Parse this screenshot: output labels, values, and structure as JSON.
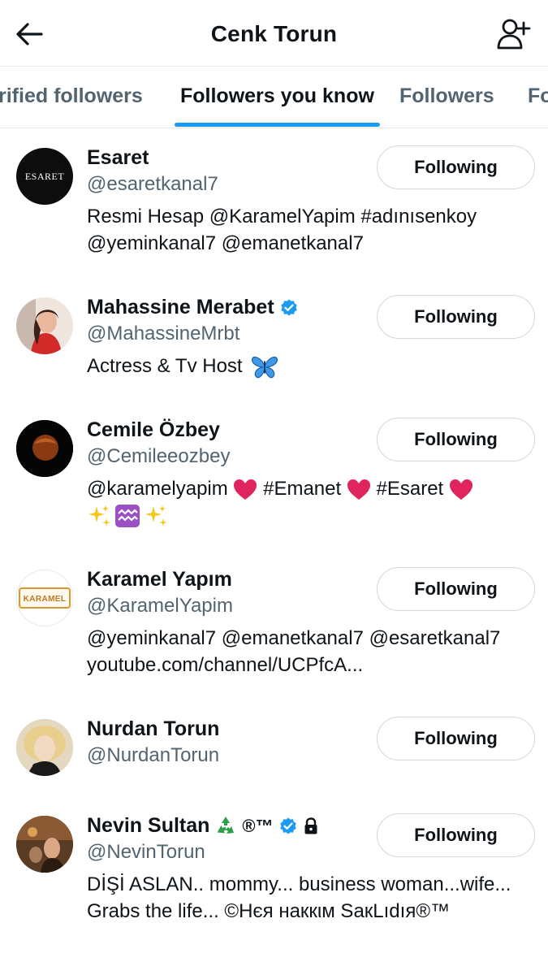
{
  "header": {
    "title": "Cenk Torun",
    "back_icon": "arrow-left-icon",
    "add_icon": "add-user-icon"
  },
  "tabs": [
    {
      "label": "rified followers",
      "active": false
    },
    {
      "label": "Followers you know",
      "active": true
    },
    {
      "label": "Followers",
      "active": false
    },
    {
      "label": "Fo",
      "active": false
    }
  ],
  "colors": {
    "accent": "#1d9bf0",
    "verified": "#1d9bf0",
    "heart": "#e0245e",
    "muted": "#536471"
  },
  "follow_label": "Following",
  "users": [
    {
      "name": "Esaret",
      "handle": "@esaretkanal7",
      "bio": [
        "Resmi Hesap @KaramelYapim #adınısenkoy",
        "@yeminkanal7 @emanetkanal7"
      ],
      "avatar_text": "ESARET",
      "verified": false
    },
    {
      "name": "Mahassine Merabet",
      "handle": "@MahassineMrbt",
      "bio": [
        "Actress & Tv Host"
      ],
      "verified": true
    },
    {
      "name": "Cemile Özbey",
      "handle": "@Cemileeozbey",
      "bio_parts": [
        "@karamelyapim",
        "#Emanet",
        "#Esaret"
      ],
      "verified": false
    },
    {
      "name": "Karamel Yapım",
      "handle": "@KaramelYapim",
      "bio": [
        "@yeminkanal7 @emanetkanal7 @esaretkanal7",
        "youtube.com/channel/UCPfcA..."
      ],
      "avatar_text": "KARAMEL",
      "verified": false
    },
    {
      "name": "Nurdan Torun",
      "handle": "@NurdanTorun",
      "bio": [],
      "verified": false
    },
    {
      "name": "Nevin Sultan",
      "name_suffix": "®™",
      "handle": "@NevinTorun",
      "bio": [
        "DİŞİ ASLAN.. mommy... business woman...wife...",
        "Grabs the life... ©Нєя нaккιм SaкLıdıя®™"
      ],
      "verified": true,
      "protected": true
    }
  ]
}
